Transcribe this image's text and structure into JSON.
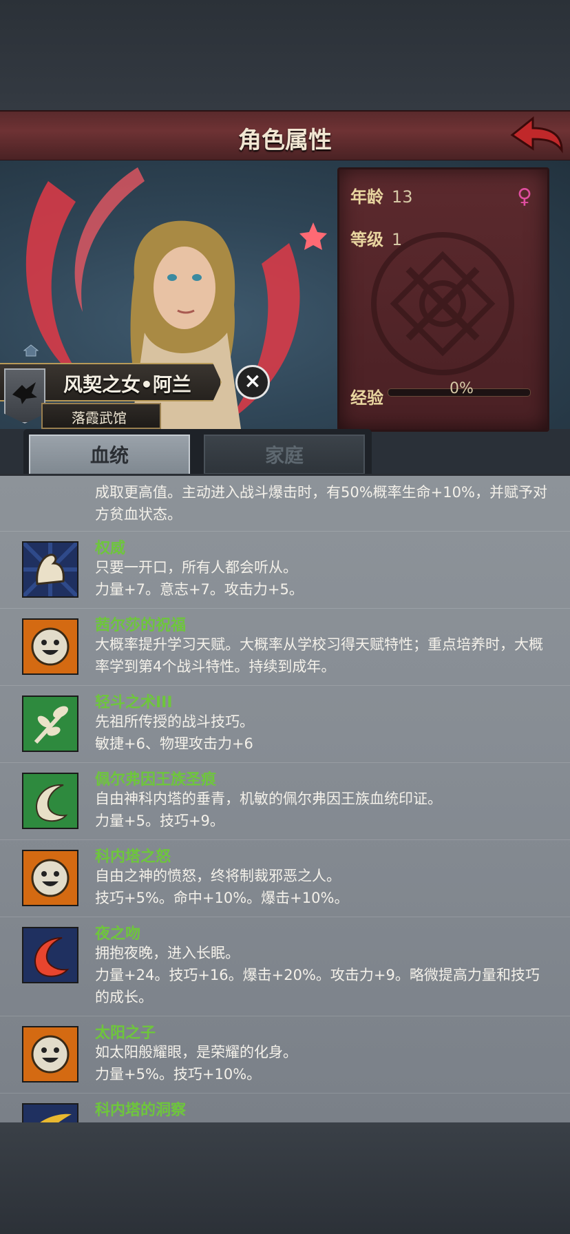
{
  "header": {
    "title": "角色属性"
  },
  "character": {
    "name": "风契之女•阿兰",
    "affiliation": "落霞武馆",
    "stats": {
      "age_label": "年龄",
      "age_value": "13",
      "level_label": "等级",
      "level_value": "1",
      "exp_label": "经验",
      "exp_percent": "0%",
      "exp_fraction": 0
    },
    "sex_symbol": "♀",
    "colors": {
      "sex": "#e04ea0",
      "trait_name": "#6ec63c",
      "title_bar": "#6e3234"
    }
  },
  "tabs": [
    {
      "label": "血统",
      "active": true
    },
    {
      "label": "家庭",
      "active": false
    }
  ],
  "intro_text": "成取更高值。主动进入战斗爆击时，有50%概率生命+10%，并赋予对方贫血状态。",
  "traits": [
    {
      "name": "权威",
      "icon": "flexed-arm-icon",
      "lines": [
        "只要一开口，所有人都会听从。",
        "力量+7。意志+7。攻击力+5。"
      ]
    },
    {
      "name": "茜尔莎的祝福",
      "icon": "smiley-sun-icon",
      "lines": [
        "大概率提升学习天赋。大概率从学校习得天赋特性；重点培养时，大概率学到第4个战斗特性。持续到成年。"
      ]
    },
    {
      "name": "轻斗之术III",
      "icon": "leaf-branch-icon",
      "lines": [
        "先祖所传授的战斗技巧。",
        "敏捷+6、物理攻击力+6"
      ]
    },
    {
      "name": "佩尔弗因王族圣痕",
      "icon": "crescent-claw-icon",
      "lines": [
        "自由神科内塔的垂青，机敏的佩尔弗因王族血统印证。",
        "力量+5。技巧+9。"
      ]
    },
    {
      "name": "科内塔之怒",
      "icon": "smiley-sun-icon",
      "lines": [
        "自由之神的愤怒，终将制裁邪恶之人。",
        "技巧+5%。命中+10%。爆击+10%。"
      ]
    },
    {
      "name": "夜之吻",
      "icon": "red-crescent-icon",
      "lines": [
        "拥抱夜晚，进入长眠。",
        "力量+24。技巧+16。爆击+20%。攻击力+9。略微提高力量和技巧的成长。"
      ]
    },
    {
      "name": "太阳之子",
      "icon": "smiley-sun-icon",
      "lines": [
        "如太阳般耀眼，是荣耀的化身。",
        "力量+5%。技巧+10%。"
      ]
    },
    {
      "name": "科内塔的洞察",
      "icon": "golden-wing-icon",
      "lines": []
    }
  ]
}
